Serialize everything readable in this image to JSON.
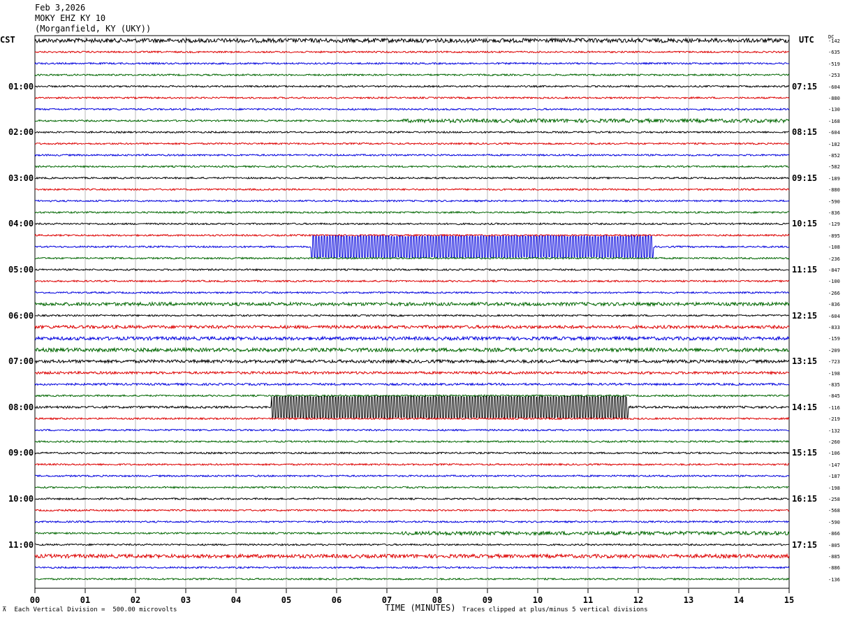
{
  "header": {
    "date": "Feb 3,2026",
    "station": "MOKY EHZ KY 10",
    "location": "(Morganfield, KY (UKY))"
  },
  "left_zone": "CST",
  "right_zone": "UTC",
  "dc_label": "DC",
  "footer": {
    "scale_note": "Each Vertical Division =  500.00 microvolts",
    "axis_title": "TIME (MINUTES)",
    "clip_note": "Traces clipped at plus/minus 5 vertical divisions"
  },
  "colors": {
    "black": "#000000",
    "red": "#dd0000",
    "blue": "#0000dd",
    "green": "#006600",
    "grid": "#b8b8b8"
  },
  "chart_data": {
    "type": "line",
    "title": "",
    "xlabel": "TIME (MINUTES)",
    "xlim": [
      0,
      15
    ],
    "x_ticks": [
      "00",
      "01",
      "02",
      "03",
      "04",
      "05",
      "06",
      "07",
      "08",
      "09",
      "10",
      "11",
      "12",
      "13",
      "14",
      "15"
    ],
    "trace_minutes": 15,
    "color_cycle": [
      "black",
      "red",
      "blue",
      "green"
    ],
    "cst_labels": [
      "01:00",
      "02:00",
      "03:00",
      "04:00",
      "05:00",
      "06:00",
      "07:00",
      "08:00",
      "09:00",
      "10:00",
      "11:00"
    ],
    "utc_labels": [
      "07:15",
      "08:15",
      "09:15",
      "10:15",
      "11:15",
      "12:15",
      "13:15",
      "14:15",
      "15:15",
      "16:15",
      "17:15"
    ],
    "dc_offsets": [
      "-142",
      "-635",
      "-519",
      "-253",
      "-604",
      "-880",
      "-130",
      "-168",
      "-604",
      "-182",
      "-852",
      "-582",
      "-189",
      "-880",
      "-590",
      "-836",
      "-129",
      "-895",
      "-108",
      "-236",
      "-847",
      "-100",
      "-266",
      "-836",
      "-604",
      "-833",
      "-159",
      "-209",
      "-723",
      "-198",
      "-835",
      "-845",
      "-116",
      "-219",
      "-132",
      "-260",
      "-106",
      "-147",
      "-187",
      "-198",
      "-258",
      "-568",
      "-590",
      "-866",
      "-805",
      "-885",
      "-886",
      "-136"
    ],
    "notable_signals": [
      {
        "trace": 18,
        "color": "blue",
        "start_min": 5.5,
        "end_min": 12.3,
        "note": "clipped"
      },
      {
        "trace": 32,
        "color": "black",
        "start_min": 4.7,
        "end_min": 11.8,
        "note": "clipped"
      },
      {
        "trace": 8,
        "color": "black",
        "start_min": 1.1,
        "end_min": 1.2,
        "note": "spike"
      }
    ]
  }
}
